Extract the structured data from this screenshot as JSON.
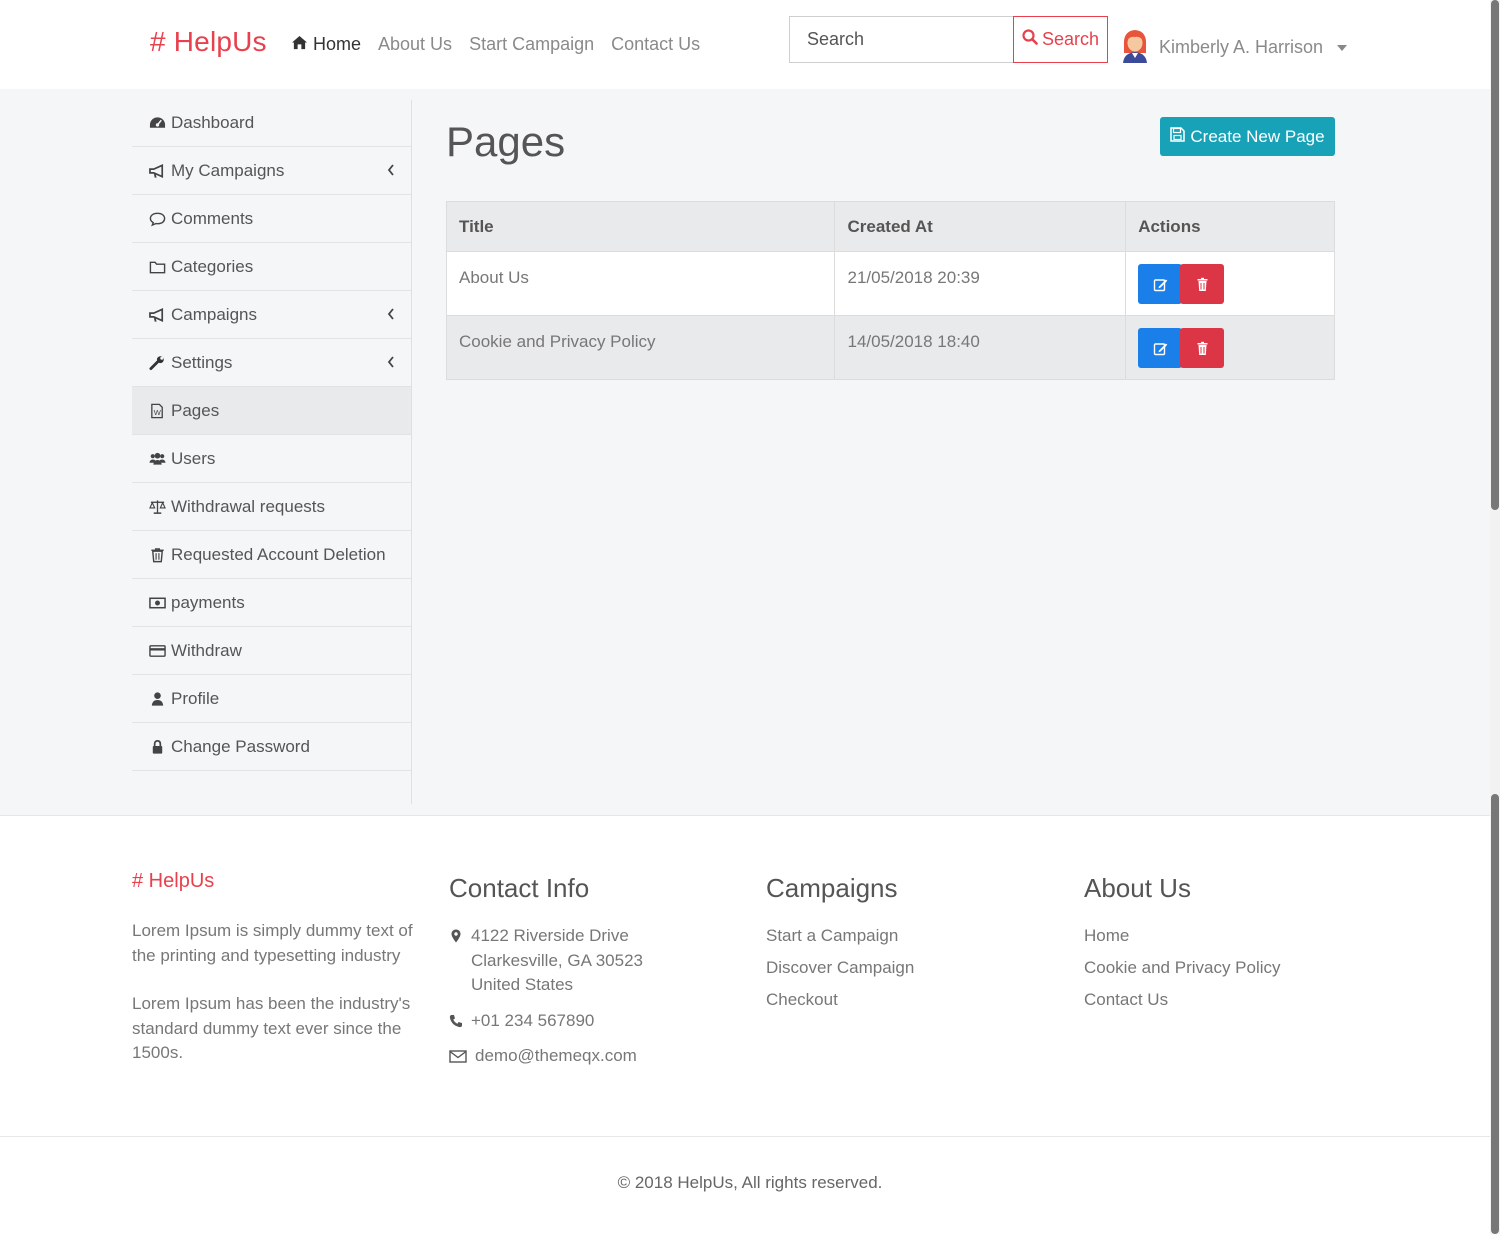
{
  "brand": "# HelpUs",
  "nav": {
    "home": "Home",
    "about": "About Us",
    "start": "Start Campaign",
    "contact": "Contact Us"
  },
  "search": {
    "placeholder": "Search",
    "button": "Search"
  },
  "user": {
    "name": "Kimberly A. Harrison"
  },
  "sidebar": {
    "items": [
      {
        "label": "Dashboard"
      },
      {
        "label": "My Campaigns"
      },
      {
        "label": "Comments"
      },
      {
        "label": "Categories"
      },
      {
        "label": "Campaigns"
      },
      {
        "label": "Settings"
      },
      {
        "label": "Pages"
      },
      {
        "label": "Users"
      },
      {
        "label": "Withdrawal requests"
      },
      {
        "label": "Requested Account Deletion"
      },
      {
        "label": "payments"
      },
      {
        "label": "Withdraw"
      },
      {
        "label": "Profile"
      },
      {
        "label": "Change Password"
      }
    ]
  },
  "main": {
    "title": "Pages",
    "create_button": "Create New Page",
    "table": {
      "headers": [
        "Title",
        "Created At",
        "Actions"
      ],
      "rows": [
        {
          "title": "About Us",
          "created_at": "21/05/2018 20:39"
        },
        {
          "title": "Cookie and Privacy Policy",
          "created_at": "14/05/2018 18:40"
        }
      ]
    }
  },
  "footer": {
    "brand": "# HelpUs",
    "about_text_1": "Lorem Ipsum is simply dummy text of the printing and typesetting industry",
    "about_text_2": "Lorem Ipsum has been the industry's standard dummy text ever since the 1500s.",
    "contact": {
      "heading": "Contact Info",
      "address_line_1": "4122 Riverside Drive",
      "address_line_2": "Clarkesville, GA 30523",
      "address_line_3": "United States",
      "phone": "+01 234 567890",
      "email": "demo@themeqx.com"
    },
    "campaigns": {
      "heading": "Campaigns",
      "links": [
        "Start a Campaign",
        "Discover Campaign",
        "Checkout"
      ]
    },
    "about": {
      "heading": "About Us",
      "links": [
        "Home",
        "Cookie and Privacy Policy",
        "Contact Us"
      ]
    },
    "copyright": "© 2018 HelpUs, All rights reserved."
  },
  "colors": {
    "brand_red": "#e8414d",
    "create_teal": "#17a2b8",
    "edit_blue": "#1a7fe8",
    "delete_red": "#dc3545"
  }
}
